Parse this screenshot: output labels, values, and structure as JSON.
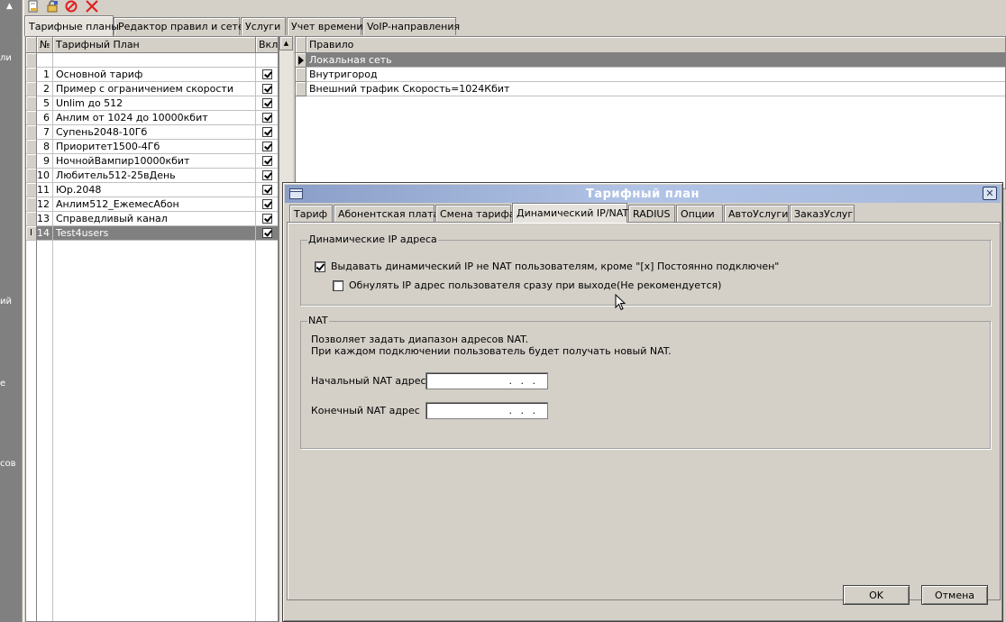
{
  "left_strip": {
    "fragments": [
      "ли",
      "ий",
      "е",
      "сов"
    ]
  },
  "toolbar": {
    "icons": [
      "edit-icon",
      "lock-icon",
      "disable-icon",
      "delete-icon"
    ]
  },
  "main_tabs": [
    {
      "label": "Тарифные планы",
      "active": true
    },
    {
      "label": "Редактор правил и сетей",
      "active": false
    },
    {
      "label": "Услуги",
      "active": false
    },
    {
      "label": "Учет времени",
      "active": false
    },
    {
      "label": "VoIP-направления",
      "active": false
    }
  ],
  "tariff_table": {
    "columns": [
      "№",
      "Тарифный План",
      "Вкл"
    ],
    "rows": [
      {
        "num": "1",
        "name": "Основной тариф",
        "enabled": true
      },
      {
        "num": "2",
        "name": "Пример с ограничением скорости",
        "enabled": true
      },
      {
        "num": "5",
        "name": "Unlim до 512",
        "enabled": true
      },
      {
        "num": "6",
        "name": "Анлим от 1024 до 10000кбит",
        "enabled": true
      },
      {
        "num": "7",
        "name": "Супень2048-10Гб",
        "enabled": true
      },
      {
        "num": "8",
        "name": "Приоритет1500-4Гб",
        "enabled": true
      },
      {
        "num": "9",
        "name": "НочнойВампир10000кбит",
        "enabled": true
      },
      {
        "num": "10",
        "name": "Любитель512-25вДень",
        "enabled": true
      },
      {
        "num": "11",
        "name": "Юр.2048",
        "enabled": true
      },
      {
        "num": "12",
        "name": "Анлим512_ЕжемесАбон",
        "enabled": true
      },
      {
        "num": "13",
        "name": "Справедливый канал",
        "enabled": true
      },
      {
        "num": "14",
        "name": "Test4users",
        "enabled": true,
        "selected": true
      }
    ]
  },
  "rules_table": {
    "header": "Правило",
    "rows": [
      {
        "text": "Локальная сеть",
        "selected": true
      },
      {
        "text": "Внутригород",
        "selected": false
      },
      {
        "text": "Внешний трафик  Скорость=1024Кбит",
        "selected": false
      }
    ]
  },
  "dialog": {
    "title": "Тарифный план",
    "tabs": [
      {
        "label": "Тариф",
        "active": false
      },
      {
        "label": "Абонентская плата",
        "active": false
      },
      {
        "label": "Смена тарифа",
        "active": false
      },
      {
        "label": "Динамический IP/NAT",
        "active": true
      },
      {
        "label": "RADIUS",
        "active": false
      },
      {
        "label": "Опции",
        "active": false
      },
      {
        "label": "АвтоУслуги",
        "active": false
      },
      {
        "label": "ЗаказУслуг",
        "active": false
      }
    ],
    "dynamic_ip": {
      "legend": "Динамические IP адреса",
      "give_dynamic_label": "Выдавать динамический IP не NAT пользователям, кроме \"[x] Постоянно подключен\"",
      "give_dynamic_checked": true,
      "reset_ip_label": "Обнулять IP адрес пользователя сразу при выходе(Не рекомендуется)",
      "reset_ip_checked": false
    },
    "nat": {
      "legend": "NAT",
      "desc1": "Позволяет задать диапазон адресов NAT.",
      "desc2": "При каждом подключении пользователь будет получать новый NAT.",
      "start_label": "Начальный NAT адрес",
      "start_value": ". . .",
      "end_label": "Конечный NAT адрес",
      "end_value": ". . ."
    },
    "ok_label": "OK",
    "cancel_label": "Отмена"
  }
}
